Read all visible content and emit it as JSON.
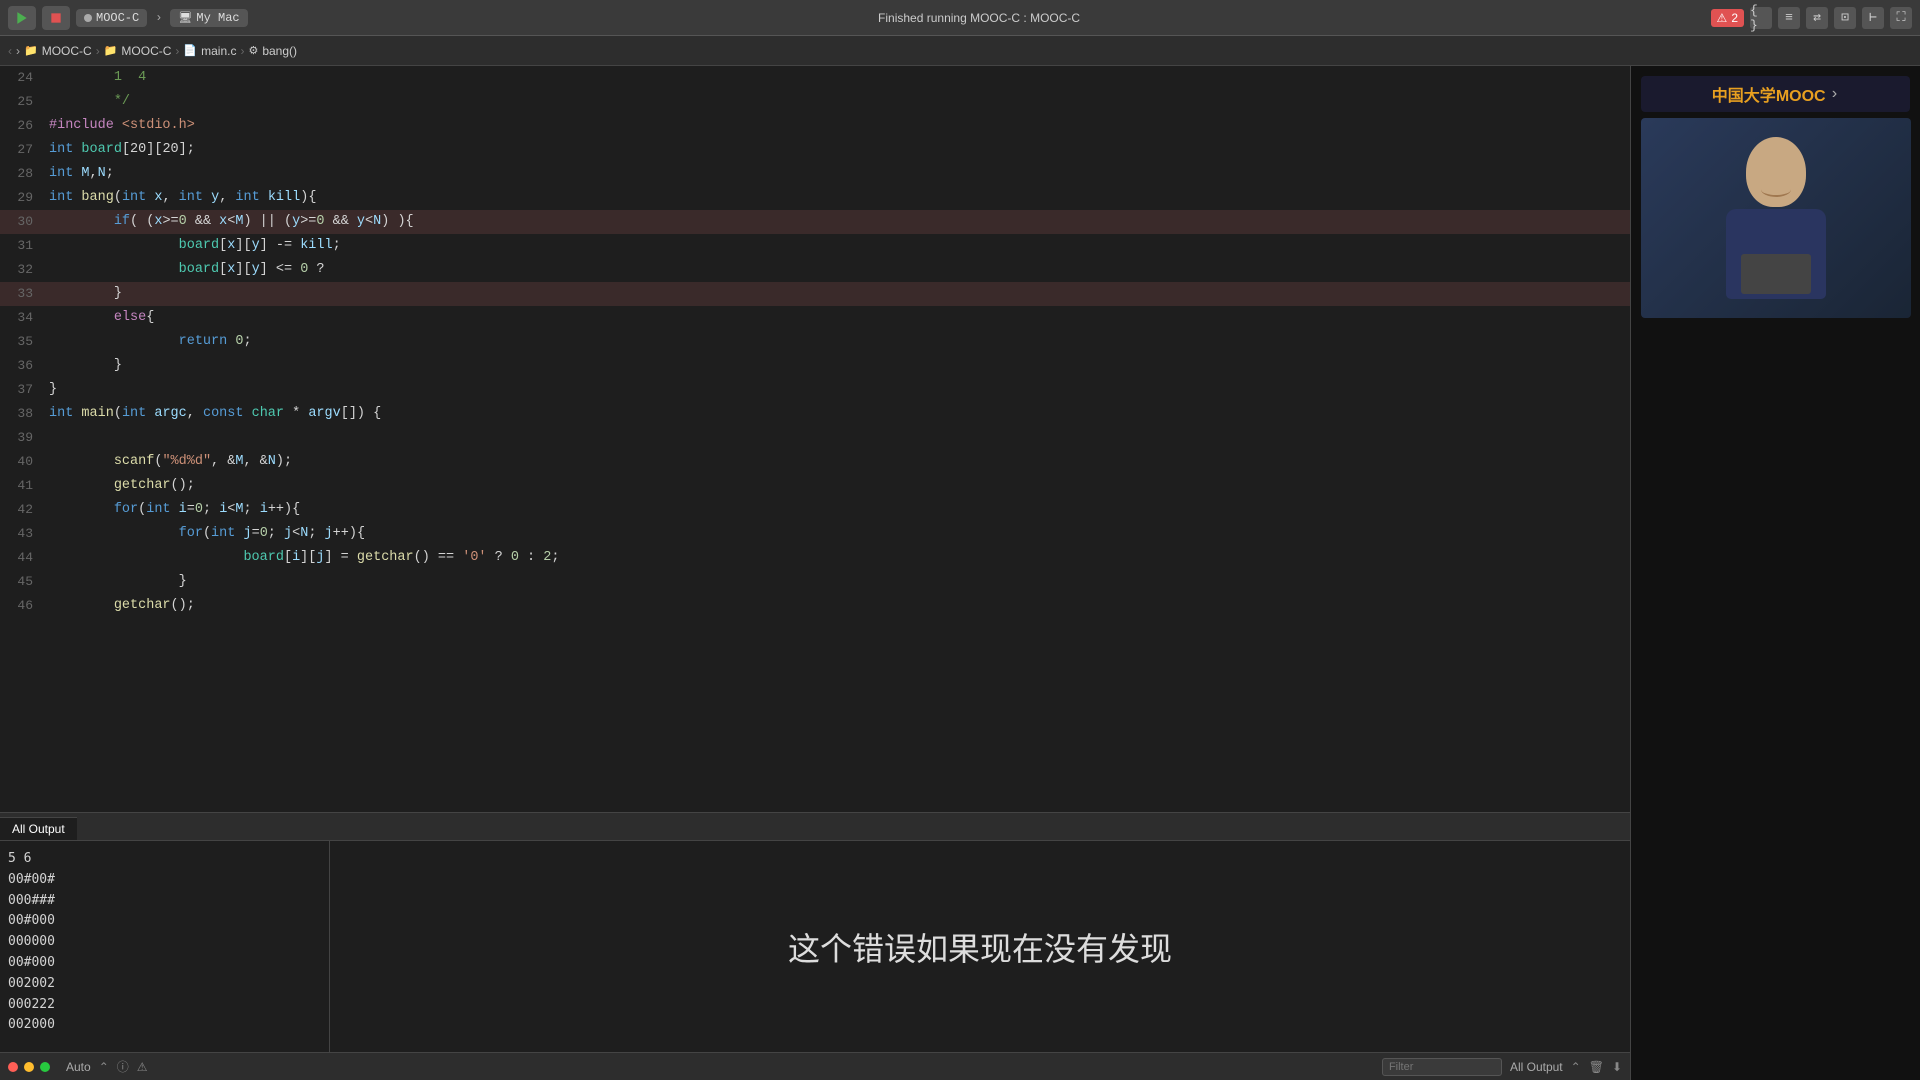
{
  "toolbar": {
    "run_button_title": "Run",
    "stop_button_title": "Stop",
    "device_label": "MOOC-C",
    "target_label": "My Mac",
    "status_text": "Finished running MOOC-C : MOOC-C",
    "error_count": "2",
    "error_icon": "⚠"
  },
  "breadcrumb": {
    "items": [
      {
        "icon": "📁",
        "label": "MOOC-C"
      },
      {
        "sep": ">"
      },
      {
        "icon": "📁",
        "label": "MOOC-C"
      },
      {
        "sep": ">"
      },
      {
        "icon": "📄",
        "label": "main.c"
      },
      {
        "sep": ">"
      },
      {
        "icon": "⚙",
        "label": "bang()"
      }
    ]
  },
  "editor": {
    "lines": [
      {
        "num": "24",
        "content": "\t1  4",
        "highlight": false
      },
      {
        "num": "25",
        "content": "\t*/",
        "highlight": false
      },
      {
        "num": "26",
        "content": "#include <stdio.h>",
        "highlight": false
      },
      {
        "num": "27",
        "content": "int board[20][20];",
        "highlight": false
      },
      {
        "num": "28",
        "content": "int M,N;",
        "highlight": false
      },
      {
        "num": "29",
        "content": "int bang(int x, int y, int kill){",
        "highlight": false
      },
      {
        "num": "30",
        "content": "\tif( (x>=0 && x<M) || (y>=0 && y<N) ){",
        "highlight": true
      },
      {
        "num": "31",
        "content": "\t\tboard[x][y] -= kill;",
        "highlight": false
      },
      {
        "num": "32",
        "content": "\t\tboard[x][y] <= 0 ?",
        "highlight": false
      },
      {
        "num": "33",
        "content": "\t}",
        "highlight": true
      },
      {
        "num": "34",
        "content": "\telse{",
        "highlight": false
      },
      {
        "num": "35",
        "content": "\t\treturn 0;",
        "highlight": false
      },
      {
        "num": "36",
        "content": "\t}",
        "highlight": false
      },
      {
        "num": "37",
        "content": "}",
        "highlight": false
      },
      {
        "num": "38",
        "content": "int main(int argc, const char * argv[]) {",
        "highlight": false
      },
      {
        "num": "39",
        "content": "",
        "highlight": false
      },
      {
        "num": "40",
        "content": "\tscanf(\"%d%d\", &M, &N);",
        "highlight": false
      },
      {
        "num": "41",
        "content": "\tgetchar();",
        "highlight": false
      },
      {
        "num": "42",
        "content": "\tfor(int i=0; i<M; i++){",
        "highlight": false
      },
      {
        "num": "43",
        "content": "\t\tfor(int j=0; j<N; j++){",
        "highlight": false
      },
      {
        "num": "44",
        "content": "\t\t\tboard[i][j] = getchar() == '0' ? 0 : 2;",
        "highlight": false
      },
      {
        "num": "45",
        "content": "\t\t}",
        "highlight": false
      },
      {
        "num": "46",
        "content": "\tgetchar();",
        "highlight": false
      }
    ]
  },
  "output": {
    "data_lines": [
      "5 6",
      "00#00#",
      "000###",
      "00#000",
      "000000",
      "00#000",
      "002002",
      "000222",
      "002000"
    ],
    "chinese_subtitle": "这个错误如果现在没有发现"
  },
  "status_bottom": {
    "auto_label": "Auto",
    "filter_placeholder": "Filter",
    "all_output_label": "All Output"
  },
  "video_panel": {
    "mooc_label": "中国大学MOOC"
  }
}
